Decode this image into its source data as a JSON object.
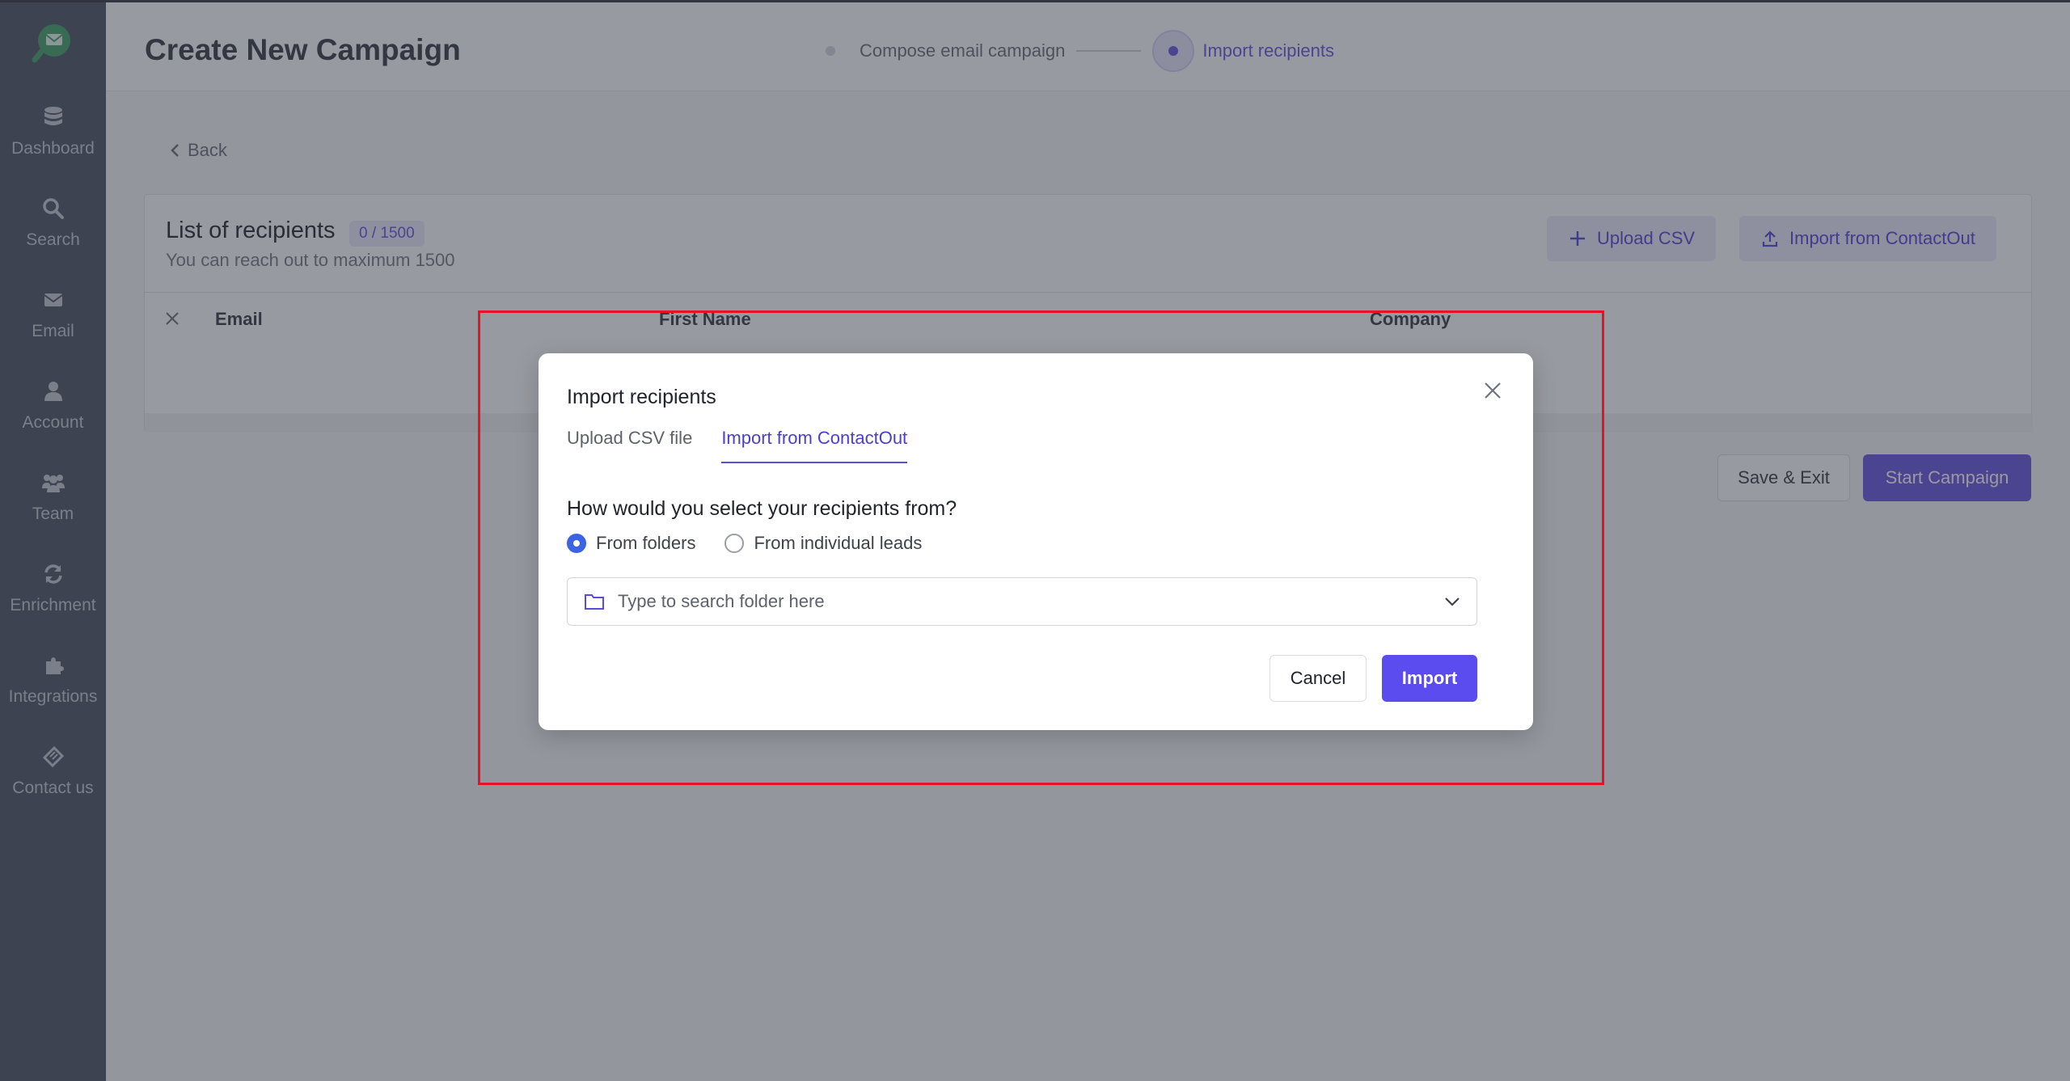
{
  "app": {
    "page_title": "Create New Campaign"
  },
  "sidebar": {
    "items": [
      {
        "label": "Dashboard",
        "icon": "database-icon"
      },
      {
        "label": "Search",
        "icon": "search-icon"
      },
      {
        "label": "Email",
        "icon": "envelope-icon"
      },
      {
        "label": "Account",
        "icon": "user-icon"
      },
      {
        "label": "Team",
        "icon": "users-icon"
      },
      {
        "label": "Enrichment",
        "icon": "refresh-icon"
      },
      {
        "label": "Integrations",
        "icon": "puzzle-icon"
      },
      {
        "label": "Contact us",
        "icon": "ticket-icon"
      }
    ]
  },
  "stepper": {
    "steps": [
      {
        "label": "Compose email campaign",
        "active": false
      },
      {
        "label": "Import recipients",
        "active": true
      }
    ]
  },
  "back_label": "Back",
  "recipients": {
    "title": "List of recipients",
    "count": "0 / 1500",
    "subtitle": "You can reach out to maximum 1500",
    "upload_csv_label": "Upload CSV",
    "import_contactout_label": "Import from ContactOut",
    "columns": [
      "Email",
      "First Name",
      "Company"
    ]
  },
  "footer": {
    "save_exit_label": "Save & Exit",
    "start_campaign_label": "Start Campaign"
  },
  "modal": {
    "title": "Import recipients",
    "tabs": [
      {
        "label": "Upload CSV file",
        "active": false
      },
      {
        "label": "Import from ContactOut",
        "active": true
      }
    ],
    "question": "How would you select your recipients from?",
    "options": [
      {
        "label": "From folders",
        "checked": true
      },
      {
        "label": "From individual leads",
        "checked": false
      }
    ],
    "folder_search_placeholder": "Type to search folder here",
    "cancel_label": "Cancel",
    "import_label": "Import"
  },
  "colors": {
    "accent": "#6a5ae0",
    "primary_button": "#5b4cf0",
    "highlight_border": "#e8102a",
    "sidebar": "#515864"
  }
}
